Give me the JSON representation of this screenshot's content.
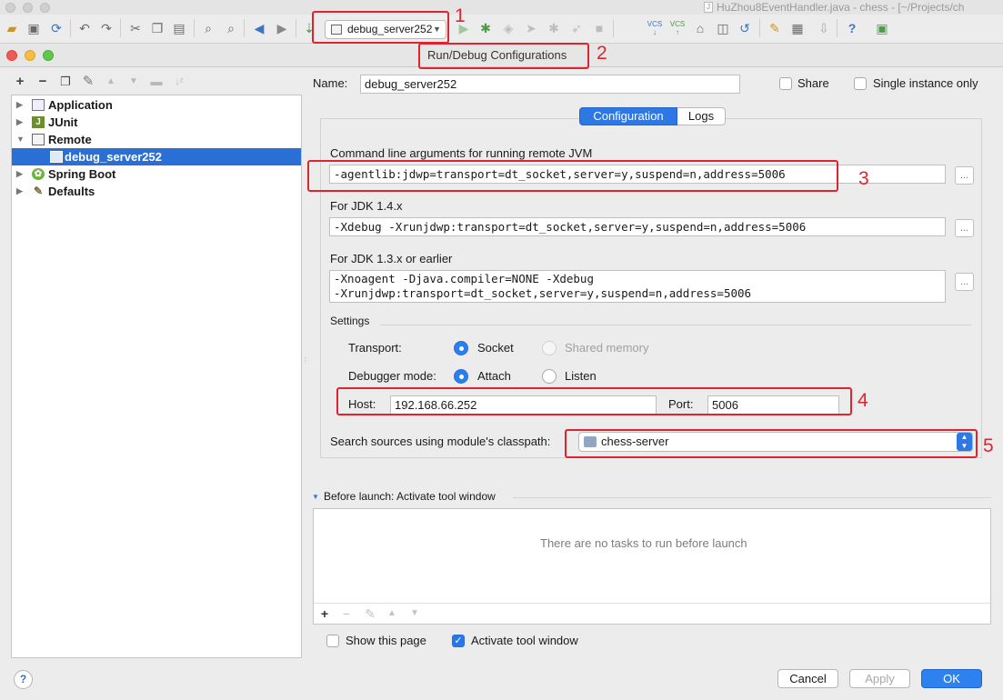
{
  "ide": {
    "title": "HuZhou8EventHandler.java - chess - [~/Projects/ch",
    "title_icon": "J",
    "run_configuration": "debug_server252"
  },
  "dialog": {
    "title": "Run/Debug Configurations"
  },
  "tree": {
    "items": [
      {
        "label": "Application",
        "icon": "application-icon",
        "expanded": false
      },
      {
        "label": "JUnit",
        "icon": "junit-icon",
        "expanded": false
      },
      {
        "label": "Remote",
        "icon": "remote-icon",
        "expanded": true
      },
      {
        "label": "debug_server252",
        "icon": "remote-config-icon",
        "selected": true
      },
      {
        "label": "Spring Boot",
        "icon": "spring-boot-icon",
        "expanded": false
      },
      {
        "label": "Defaults",
        "icon": "wrench-icon",
        "expanded": false
      }
    ]
  },
  "form": {
    "name_label": "Name:",
    "name_value": "debug_server252",
    "share_label": "Share",
    "share_checked": false,
    "single_instance_label": "Single instance only",
    "single_instance_checked": false,
    "tabs": [
      "Configuration",
      "Logs"
    ],
    "active_tab": "Configuration",
    "cmdline_label": "Command line arguments for running remote JVM",
    "cmdline_value": "-agentlib:jdwp=transport=dt_socket,server=y,suspend=n,address=5006",
    "jdk14_label": "For JDK 1.4.x",
    "jdk14_value": "-Xdebug -Xrunjdwp:transport=dt_socket,server=y,suspend=n,address=5006",
    "jdk13_label": "For JDK 1.3.x or earlier",
    "jdk13_line1": "-Xnoagent -Djava.compiler=NONE -Xdebug",
    "jdk13_line2": "-Xrunjdwp:transport=dt_socket,server=y,suspend=n,address=5006",
    "ellipsis": "...",
    "settings_label": "Settings",
    "transport_label": "Transport:",
    "transport_options": [
      "Socket",
      "Shared memory"
    ],
    "transport_selected": "Socket",
    "debugger_mode_label": "Debugger mode:",
    "debugger_mode_options": [
      "Attach",
      "Listen"
    ],
    "debugger_mode_selected": "Attach",
    "host_label": "Host:",
    "host_value": "192.168.66.252",
    "port_label": "Port:",
    "port_value": "5006",
    "classpath_label": "Search sources using module's classpath:",
    "module_value": "chess-server"
  },
  "before_launch": {
    "label": "Before launch: Activate tool window",
    "empty_text": "There are no tasks to run before launch",
    "show_page_label": "Show this page",
    "show_page_checked": false,
    "activate_label": "Activate tool window",
    "activate_checked": true
  },
  "buttons": {
    "help": "?",
    "cancel": "Cancel",
    "apply": "Apply",
    "ok": "OK"
  },
  "annotations": [
    "1",
    "2",
    "3",
    "4",
    "5"
  ],
  "colors": {
    "accent": "#2e78e6",
    "annotation_red": "#e0242f",
    "selection": "#2a6fd6"
  }
}
